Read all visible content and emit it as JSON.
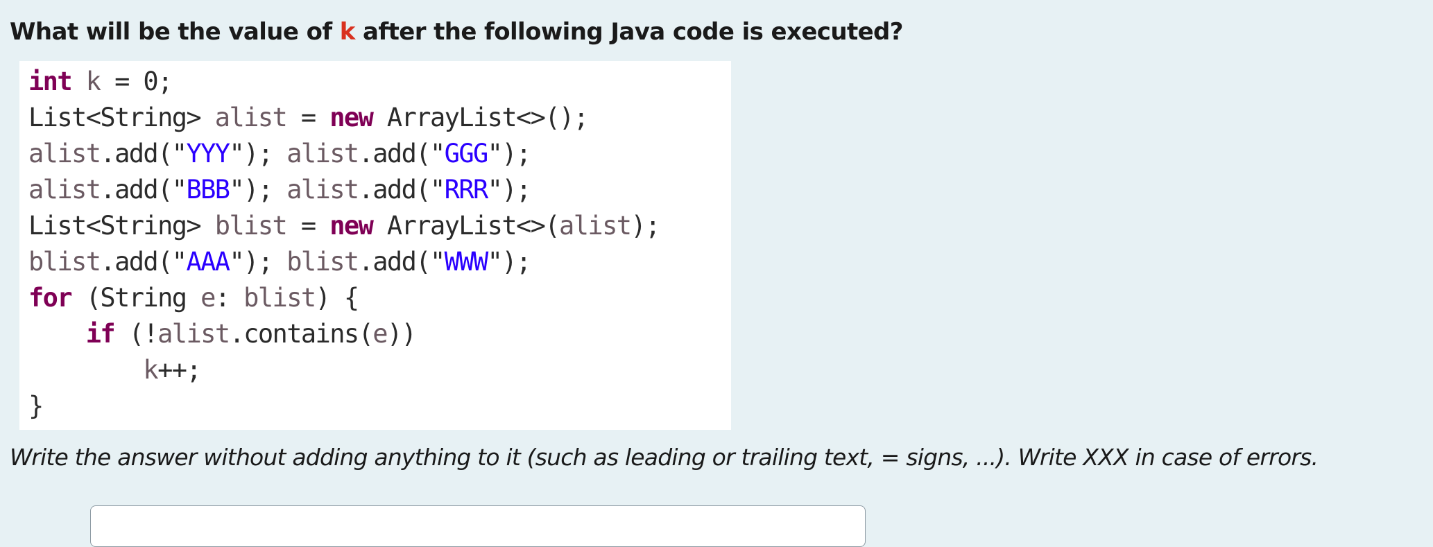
{
  "question": {
    "prefix": "What will be the value of ",
    "variable": "k",
    "suffix": " after the following Java code is executed?"
  },
  "code": {
    "line1": {
      "kw": "int",
      "var": " k",
      "rest": " = 0;"
    },
    "line2": {
      "a": "List<String>",
      "var": " alist",
      "b": " = ",
      "kw": "new",
      "c": " ArrayList<>();"
    },
    "line3": {
      "v1": "alist",
      "m1": ".add(\"",
      "s1": "YYY",
      "e1": "\");",
      "v2": " alist",
      "m2": ".add(\"",
      "s2": "GGG",
      "e2": "\");"
    },
    "line4": {
      "v1": "alist",
      "m1": ".add(\"",
      "s1": "BBB",
      "e1": "\");",
      "v2": " alist",
      "m2": ".add(\"",
      "s2": "RRR",
      "e2": "\");"
    },
    "line5": {
      "a": "List<String>",
      "var": " blist",
      "b": " = ",
      "kw": "new",
      "c": " ArrayList<>(",
      "var2": "alist",
      "d": ");"
    },
    "line6": {
      "v1": "blist",
      "m1": ".add(\"",
      "s1": "AAA",
      "e1": "\");",
      "v2": " blist",
      "m2": ".add(\"",
      "s2": "WWW",
      "e2": "\");"
    },
    "line7": {
      "kw": "for",
      "a": " (String ",
      "var": "e",
      "b": ": ",
      "var2": "blist",
      "c": ") {"
    },
    "line8": {
      "indent": "    ",
      "kw": "if",
      "a": " (!",
      "var": "alist",
      "b": ".contains(",
      "var2": "e",
      "c": "))"
    },
    "line9": {
      "indent": "        ",
      "var": "k",
      "a": "++;"
    },
    "line10": {
      "a": "}"
    }
  },
  "instructions": "Write the answer without adding anything to it (such as leading or trailing text, = signs, ...). Write XXX in case of errors.",
  "answer": {
    "value": "",
    "placeholder": ""
  },
  "colors": {
    "background": "#e7f1f4",
    "keyword": "#7f0055",
    "string": "#2a00ff",
    "variable": "#6b5a62",
    "highlight": "#d9311f"
  }
}
